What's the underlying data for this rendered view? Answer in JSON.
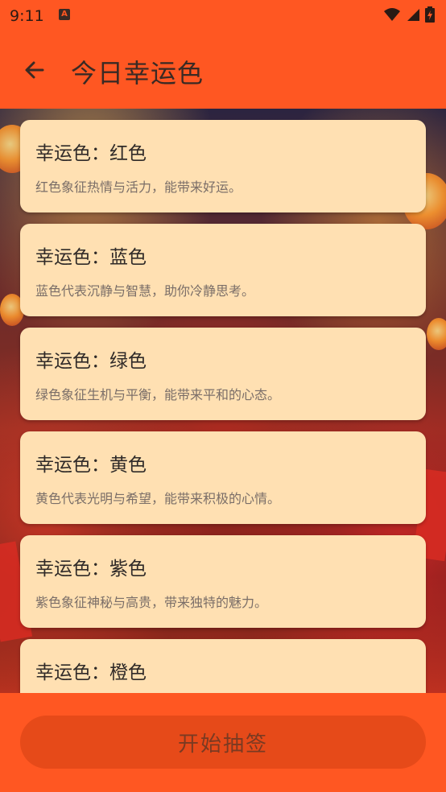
{
  "status_bar": {
    "time": "9:11",
    "notification_icon": "A"
  },
  "app_bar": {
    "back_icon": "arrow-left-icon",
    "title": "今日幸运色"
  },
  "colors": {
    "primary": "#FF5722",
    "card_bg": "#FFE0B2",
    "button_bg": "#E64A19"
  },
  "lucky_colors": [
    {
      "title": "幸运色：红色",
      "desc": "红色象征热情与活力，能带来好运。"
    },
    {
      "title": "幸运色：蓝色",
      "desc": "蓝色代表沉静与智慧，助你冷静思考。"
    },
    {
      "title": "幸运色：绿色",
      "desc": "绿色象征生机与平衡，能带来平和的心态。"
    },
    {
      "title": "幸运色：黄色",
      "desc": "黄色代表光明与希望，能带来积极的心情。"
    },
    {
      "title": "幸运色：紫色",
      "desc": "紫色象征神秘与高贵，带来独特的魅力。"
    },
    {
      "title": "幸运色：橙色",
      "desc": ""
    }
  ],
  "bottom": {
    "draw_button_label": "开始抽签"
  }
}
